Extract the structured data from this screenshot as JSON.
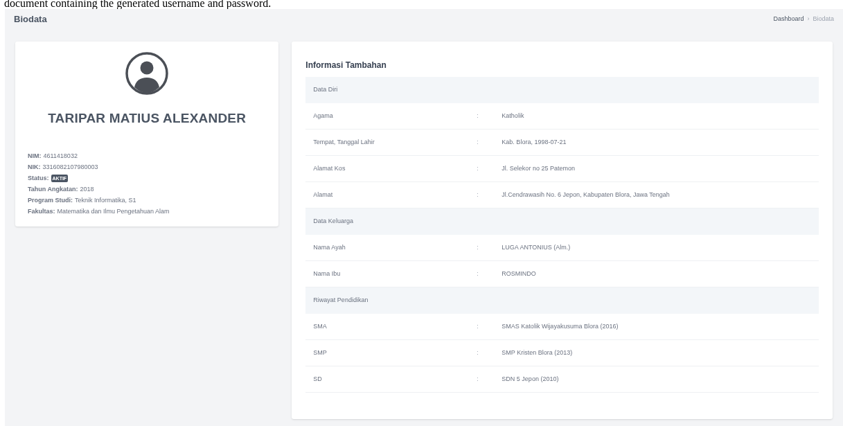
{
  "document_text": "document containing the generated username and password.",
  "page": {
    "title": "Biodata",
    "breadcrumb_separator": "›",
    "breadcrumbs": [
      {
        "label": "Dashboard",
        "selected": false
      },
      {
        "label": "Biodata",
        "selected": true
      }
    ]
  },
  "profile": {
    "name": "TARIPAR MATIUS ALEXANDER",
    "fields": [
      {
        "label": "NIM:",
        "value": "4611418032",
        "kind": "text"
      },
      {
        "label": "NIK:",
        "value": "3316082107980003",
        "kind": "text"
      },
      {
        "label": "Status:",
        "value": "AKTIF",
        "kind": "badge"
      },
      {
        "label": "Tahun Angkatan:",
        "value": "2018",
        "kind": "text"
      },
      {
        "label": "Program Studi:",
        "value": "Teknik Informatika, S1",
        "kind": "text"
      },
      {
        "label": "Fakultas:",
        "value": "Matematika dan Ilmu Pengetahuan Alam",
        "kind": "text"
      }
    ]
  },
  "info": {
    "title": "Informasi Tambahan",
    "rows": [
      {
        "kind": "section",
        "label": "Data Diri"
      },
      {
        "kind": "field",
        "label": "Agama",
        "separator": ":",
        "value": "Katholik"
      },
      {
        "kind": "field",
        "label": "Tempat, Tanggal Lahir",
        "separator": ":",
        "value": "Kab. Blora, 1998-07-21"
      },
      {
        "kind": "field",
        "label": "Alamat Kos",
        "separator": ":",
        "value": "Jl. Selekor no 25 Patemon"
      },
      {
        "kind": "field",
        "label": "Alamat",
        "separator": ":",
        "value": "Jl.Cendrawasih No. 6 Jepon, Kabupaten Blora, Jawa Tengah"
      },
      {
        "kind": "section",
        "label": "Data Keluarga"
      },
      {
        "kind": "field",
        "label": "Nama Ayah",
        "separator": ":",
        "value": "LUGA ANTONIUS (Alm.)"
      },
      {
        "kind": "field",
        "label": "Nama Ibu",
        "separator": ":",
        "value": "ROSMINDO"
      },
      {
        "kind": "section",
        "label": "Riwayat Pendidikan"
      },
      {
        "kind": "field",
        "label": "SMA",
        "separator": ":",
        "value": "SMAS Katolik Wijayakusuma Blora (2016)"
      },
      {
        "kind": "field",
        "label": "SMP",
        "separator": ":",
        "value": "SMP Kristen Blora (2013)"
      },
      {
        "kind": "field",
        "label": "SD",
        "separator": ":",
        "value": "SDN 5 Jepon (2010)"
      }
    ]
  }
}
